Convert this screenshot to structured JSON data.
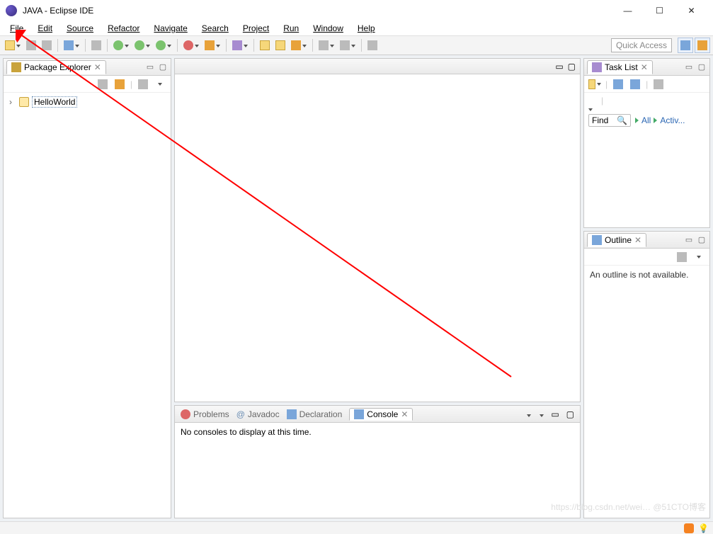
{
  "titlebar": {
    "title": "JAVA - Eclipse IDE"
  },
  "menu": {
    "items": [
      "File",
      "Edit",
      "Source",
      "Refactor",
      "Navigate",
      "Search",
      "Project",
      "Run",
      "Window",
      "Help"
    ]
  },
  "quick_access": {
    "placeholder": "Quick Access"
  },
  "package_explorer": {
    "title": "Package Explorer",
    "project": "HelloWorld"
  },
  "task_list": {
    "title": "Task List",
    "find_label": "Find",
    "all_label": "All",
    "activ_label": "Activ..."
  },
  "outline": {
    "title": "Outline",
    "empty_text": "An outline is not available."
  },
  "bottom": {
    "tabs": {
      "problems": "Problems",
      "javadoc": "Javadoc",
      "declaration": "Declaration",
      "console": "Console"
    },
    "console_empty": "No consoles to display at this time."
  },
  "watermark": "https://blog.csdn.net/wei… @51CTO博客"
}
